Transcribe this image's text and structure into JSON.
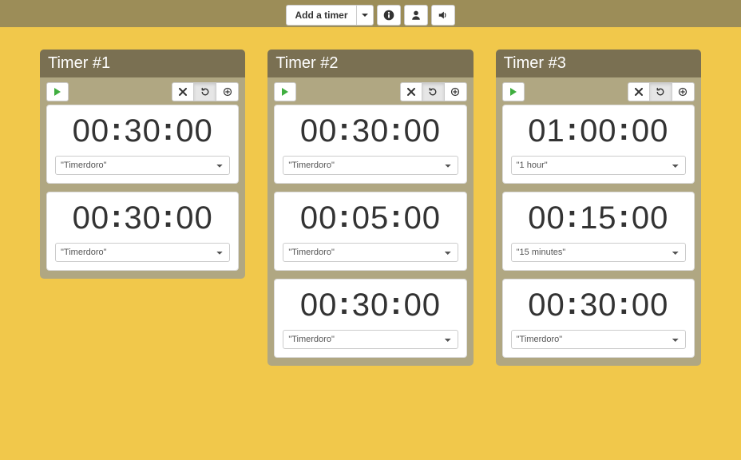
{
  "toolbar": {
    "add_timer_label": "Add a timer"
  },
  "timers": [
    {
      "title": "Timer #1",
      "segments": [
        {
          "hh": "00",
          "mm": "30",
          "ss": "00",
          "preset": "\"Timerdoro\""
        },
        {
          "hh": "00",
          "mm": "30",
          "ss": "00",
          "preset": "\"Timerdoro\""
        }
      ]
    },
    {
      "title": "Timer #2",
      "segments": [
        {
          "hh": "00",
          "mm": "30",
          "ss": "00",
          "preset": "\"Timerdoro\""
        },
        {
          "hh": "00",
          "mm": "05",
          "ss": "00",
          "preset": "\"Timerdoro\""
        },
        {
          "hh": "00",
          "mm": "30",
          "ss": "00",
          "preset": "\"Timerdoro\""
        }
      ]
    },
    {
      "title": "Timer #3",
      "segments": [
        {
          "hh": "01",
          "mm": "00",
          "ss": "00",
          "preset": "\"1 hour\""
        },
        {
          "hh": "00",
          "mm": "15",
          "ss": "00",
          "preset": "\"15 minutes\""
        },
        {
          "hh": "00",
          "mm": "30",
          "ss": "00",
          "preset": "\"Timerdoro\""
        }
      ]
    }
  ]
}
